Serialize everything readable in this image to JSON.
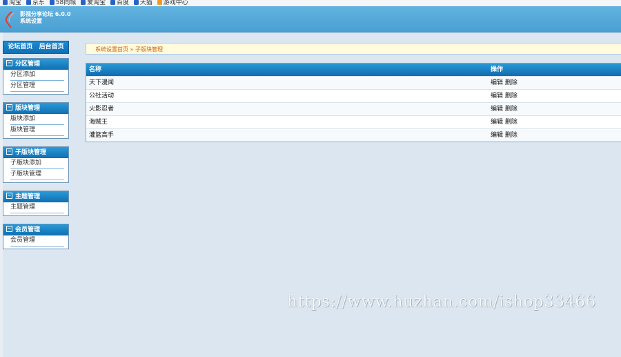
{
  "bookmarks": [
    {
      "label": "淘宝",
      "color": "#2a62c4"
    },
    {
      "label": "京东",
      "color": "#2a62c4"
    },
    {
      "label": "58同城",
      "color": "#2a62c4"
    },
    {
      "label": "爱淘宝",
      "color": "#2a62c4"
    },
    {
      "label": "百度",
      "color": "#2a62c4"
    },
    {
      "label": "天猫",
      "color": "#2a62c4"
    },
    {
      "label": "游戏中心",
      "color": "#f19a1c"
    }
  ],
  "header": {
    "title_line1": "影视分享论坛 6.0.0",
    "title_line2": "系统设置"
  },
  "sidebar": {
    "home_links": [
      "论坛首页",
      "后台首页"
    ],
    "menus": [
      {
        "title": "分区管理",
        "items": [
          "分区添加",
          "分区管理"
        ]
      },
      {
        "title": "版块管理",
        "items": [
          "版块添加",
          "版块管理"
        ]
      },
      {
        "title": "子版块管理",
        "items": [
          "子版块添加",
          "子版块管理"
        ]
      },
      {
        "title": "主题管理",
        "items": [
          "主题管理"
        ]
      },
      {
        "title": "会员管理",
        "items": [
          "会员管理"
        ]
      }
    ]
  },
  "breadcrumb": {
    "home": "系统设置首页",
    "sep": " » ",
    "current": "子版块管理"
  },
  "table": {
    "headers": [
      "名称",
      "操作"
    ],
    "rows": [
      {
        "name": "天下漫闻",
        "edit": "编辑",
        "delete": "删除"
      },
      {
        "name": "公社活动",
        "edit": "编辑",
        "delete": "删除"
      },
      {
        "name": "火影忍者",
        "edit": "编辑",
        "delete": "删除"
      },
      {
        "name": "海贼王",
        "edit": "编辑",
        "delete": "删除"
      },
      {
        "name": "灌篮高手",
        "edit": "编辑",
        "delete": "删除"
      }
    ]
  },
  "watermark": "https://www.huzhan.com/ishop33466",
  "colors": {
    "header": "#4aa0d3",
    "accent": "#106fb1",
    "background": "#dce6f0",
    "breadcrumb_text": "#d06010"
  }
}
